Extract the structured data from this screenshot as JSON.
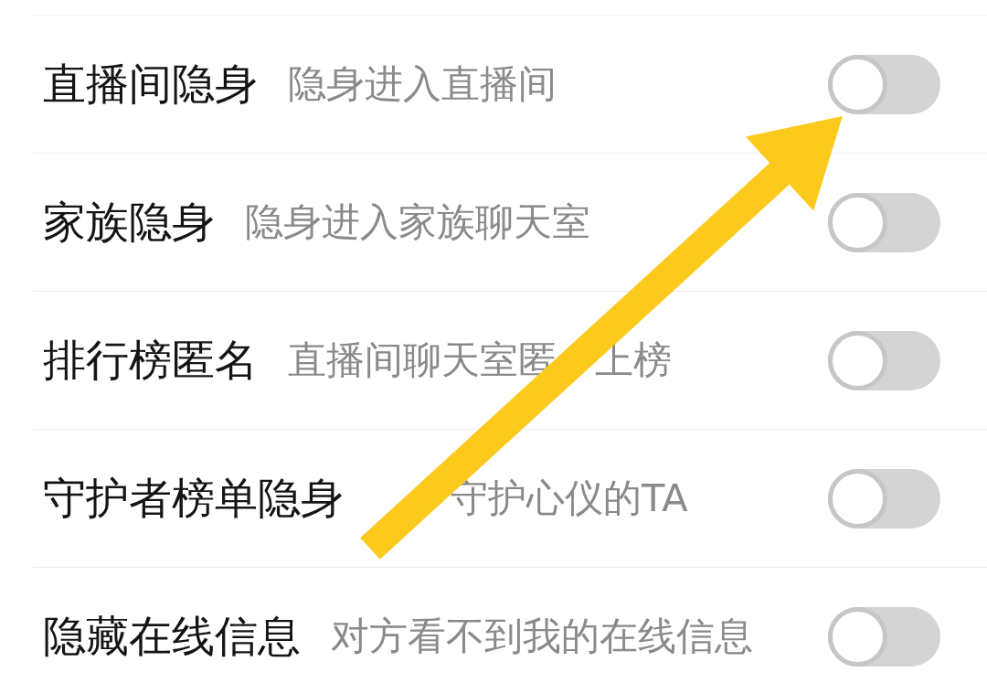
{
  "settings": [
    {
      "title": "直播间隐身",
      "subtitle": [
        {
          "kind": "text",
          "text": "隐身进入直播间"
        }
      ],
      "on": false
    },
    {
      "title": "家族隐身",
      "subtitle": [
        {
          "kind": "text",
          "text": "隐身进入家族聊天室"
        }
      ],
      "on": false
    },
    {
      "title": "排行榜匿名",
      "subtitle": [
        {
          "kind": "text",
          "text": "直播间聊天室匿"
        },
        {
          "kind": "covered"
        },
        {
          "kind": "text",
          "text": "上榜"
        }
      ],
      "on": false
    },
    {
      "title": "守护者榜单隐身",
      "subtitle": [
        {
          "kind": "covered"
        },
        {
          "kind": "covered"
        },
        {
          "kind": "text",
          "text": "守护心仪的TA"
        }
      ],
      "on": false
    },
    {
      "title": "隐藏在线信息",
      "subtitle": [
        {
          "kind": "text",
          "text": "对方看不到我的在线信息"
        }
      ],
      "on": false
    }
  ]
}
